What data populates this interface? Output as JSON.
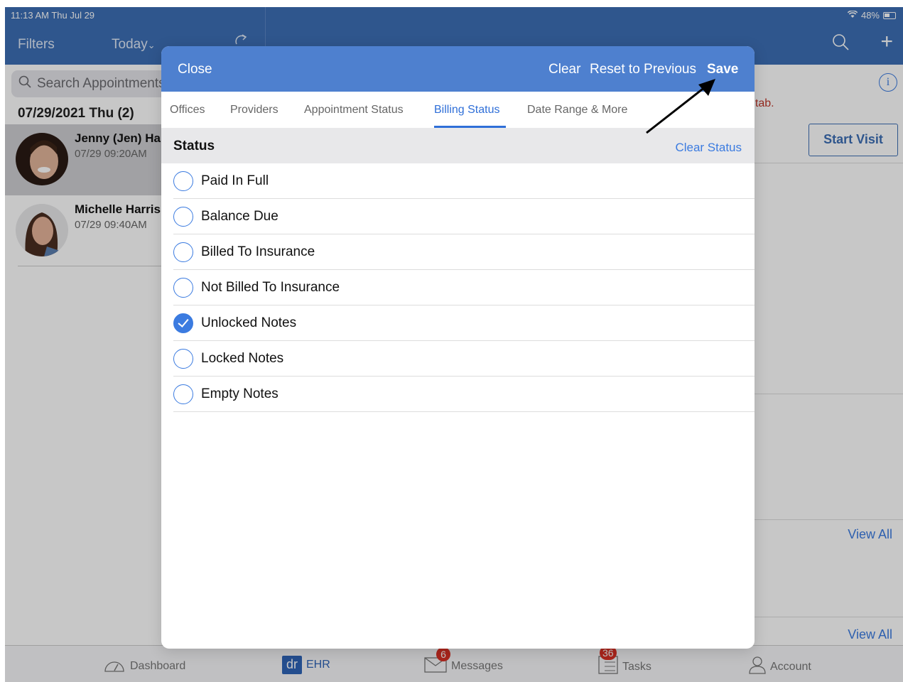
{
  "status_bar": {
    "time": "11:13 AM  Thu Jul 29",
    "battery": "48%"
  },
  "nav": {
    "filters": "Filters",
    "today": "Today",
    "today_chevron": "⌄"
  },
  "sidebar": {
    "search_placeholder": "Search Appointments",
    "date_header": "07/29/2021 Thu (2)",
    "appointments": [
      {
        "name": "Jenny (Jen) Harrison",
        "time": "07/29 09:20AM"
      },
      {
        "name": "Michelle Harris",
        "time": "07/29 09:40AM"
      }
    ]
  },
  "main": {
    "notice": "t tab.",
    "start_visit": "Start Visit",
    "view_all_1": "View All",
    "view_all_2": "View All"
  },
  "tabbar": {
    "dashboard": "Dashboard",
    "ehr_logo": "dr",
    "ehr": "EHR",
    "messages": "Messages",
    "messages_badge": "6",
    "tasks": "Tasks",
    "tasks_badge": "36",
    "account": "Account"
  },
  "modal": {
    "close": "Close",
    "clear": "Clear",
    "reset": "Reset to Previous",
    "save": "Save",
    "tabs": [
      "Offices",
      "Providers",
      "Appointment Status",
      "Billing Status",
      "Date Range & More"
    ],
    "active_tab": "Billing Status",
    "section_title": "Status",
    "clear_status": "Clear Status",
    "options": [
      {
        "label": "Paid In Full",
        "checked": false
      },
      {
        "label": "Balance Due",
        "checked": false
      },
      {
        "label": "Billed To Insurance",
        "checked": false
      },
      {
        "label": "Not Billed To Insurance",
        "checked": false
      },
      {
        "label": "Unlocked Notes",
        "checked": true
      },
      {
        "label": "Locked Notes",
        "checked": false
      },
      {
        "label": "Empty Notes",
        "checked": false
      }
    ]
  },
  "colors": {
    "header_blue": "#3d6fb5",
    "modal_header": "#4e80cf",
    "accent": "#3b7be0",
    "badge_red": "#d93025"
  }
}
